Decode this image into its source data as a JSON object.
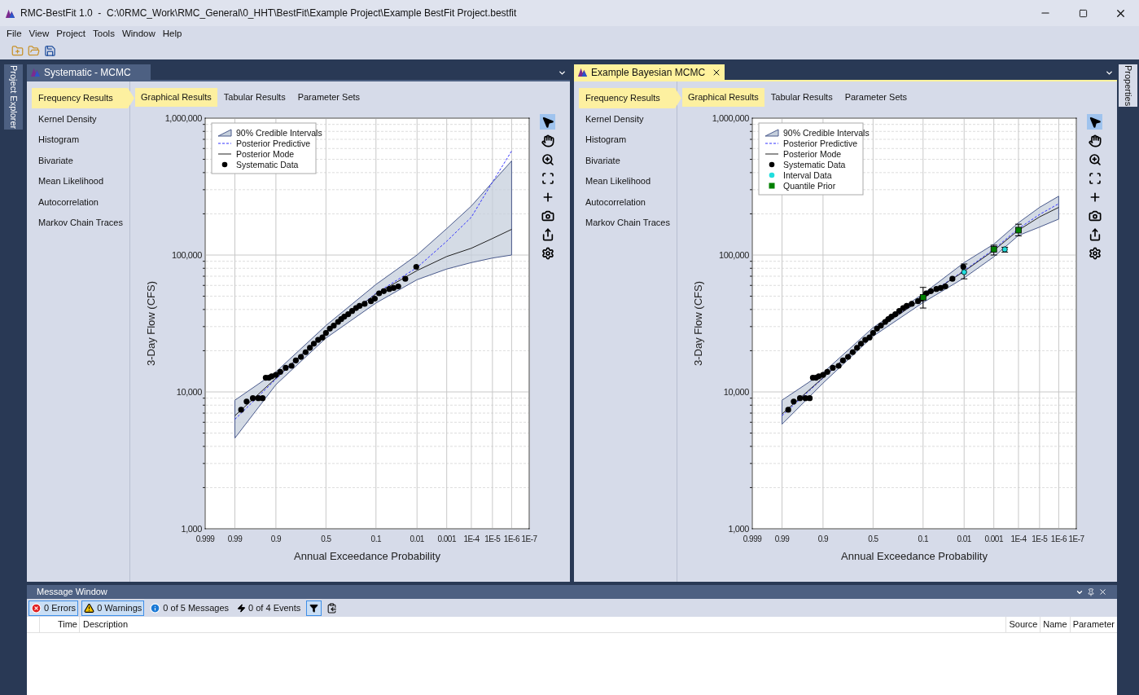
{
  "window": {
    "title": "RMC-BestFit 1.0  -  C:\\0RMC_Work\\RMC_General\\0_HHT\\BestFit\\Example Project\\Example BestFit Project.bestfit"
  },
  "menu": [
    "File",
    "View",
    "Project",
    "Tools",
    "Window",
    "Help"
  ],
  "left_sidebar": {
    "label": "Project Explorer"
  },
  "right_sidebar": {
    "label": "Properties"
  },
  "documents": [
    {
      "title": "Systematic - MCMC",
      "selected": false,
      "nav": [
        {
          "label": "Frequency Results",
          "selected": true
        },
        {
          "label": "Kernel Density",
          "selected": false
        },
        {
          "label": "Histogram",
          "selected": false
        },
        {
          "label": "Bivariate",
          "selected": false
        },
        {
          "label": "Mean Likelihood",
          "selected": false
        },
        {
          "label": "Autocorrelation",
          "selected": false
        },
        {
          "label": "Markov Chain Traces",
          "selected": false
        }
      ],
      "tabs": [
        {
          "label": "Graphical Results",
          "selected": true
        },
        {
          "label": "Tabular Results",
          "selected": false
        },
        {
          "label": "Parameter Sets",
          "selected": false
        }
      ],
      "tools": [
        {
          "kind": "pointer",
          "selected": true
        },
        {
          "kind": "pan",
          "selected": false
        },
        {
          "kind": "zoom",
          "selected": false
        },
        {
          "kind": "fit",
          "selected": false
        },
        {
          "kind": "add",
          "selected": false
        },
        {
          "kind": "camera",
          "selected": false
        },
        {
          "kind": "export",
          "selected": false
        },
        {
          "kind": "settings",
          "selected": false
        }
      ],
      "plot": {
        "x_axis_title": "Annual Exceedance Probability",
        "y_axis_title": "3-Day Flow (CFS)",
        "x_tick_labels": [
          "0.999",
          "0.99",
          "0.9",
          "0.5",
          "0.1",
          "0.01",
          "0.001",
          "1E-4",
          "1E-5",
          "1E-6",
          "1E-7"
        ],
        "y_tick_labels": [
          "1,000,000",
          "100,000",
          "10,000",
          "1,000"
        ],
        "legend": [
          {
            "kind": "band",
            "label": "90% Credible Intervals"
          },
          {
            "kind": "dashed_line",
            "label": "Posterior Predictive"
          },
          {
            "kind": "line",
            "label": "Posterior Mode"
          },
          {
            "kind": "circle",
            "label": "Systematic Data",
            "color": "#000000"
          }
        ]
      }
    },
    {
      "title": "Example Bayesian MCMC",
      "selected": true,
      "nav": [
        {
          "label": "Frequency Results",
          "selected": true
        },
        {
          "label": "Kernel Density",
          "selected": false
        },
        {
          "label": "Histogram",
          "selected": false
        },
        {
          "label": "Bivariate",
          "selected": false
        },
        {
          "label": "Mean Likelihood",
          "selected": false
        },
        {
          "label": "Autocorrelation",
          "selected": false
        },
        {
          "label": "Markov Chain Traces",
          "selected": false
        }
      ],
      "tabs": [
        {
          "label": "Graphical Results",
          "selected": true
        },
        {
          "label": "Tabular Results",
          "selected": false
        },
        {
          "label": "Parameter Sets",
          "selected": false
        }
      ],
      "tools": [
        {
          "kind": "pointer",
          "selected": true
        },
        {
          "kind": "pan",
          "selected": false
        },
        {
          "kind": "zoom",
          "selected": false
        },
        {
          "kind": "fit",
          "selected": false
        },
        {
          "kind": "add",
          "selected": false
        },
        {
          "kind": "camera",
          "selected": false
        },
        {
          "kind": "export",
          "selected": false
        },
        {
          "kind": "settings",
          "selected": false
        }
      ],
      "plot": {
        "x_axis_title": "Annual Exceedance Probability",
        "y_axis_title": "3-Day Flow (CFS)",
        "x_tick_labels": [
          "0.999",
          "0.99",
          "0.9",
          "0.5",
          "0.1",
          "0.01",
          "0.001",
          "1E-4",
          "1E-5",
          "1E-6",
          "1E-7"
        ],
        "y_tick_labels": [
          "1,000,000",
          "100,000",
          "10,000",
          "1,000"
        ],
        "legend": [
          {
            "kind": "band",
            "label": "90% Credible Intervals"
          },
          {
            "kind": "dashed_line",
            "label": "Posterior Predictive"
          },
          {
            "kind": "line",
            "label": "Posterior Mode"
          },
          {
            "kind": "circle",
            "label": "Systematic Data",
            "color": "#000000"
          },
          {
            "kind": "circle",
            "label": "Interval Data",
            "color": "#22dddd"
          },
          {
            "kind": "square",
            "label": "Quantile Prior",
            "color": "#008000"
          }
        ]
      }
    }
  ],
  "message_window": {
    "title": "Message Window",
    "filters": [
      {
        "kind": "error",
        "label": "0 Errors",
        "selected": true
      },
      {
        "kind": "warning",
        "label": "0 Warnings",
        "selected": true
      },
      {
        "kind": "info",
        "label": "0 of 5 Messages",
        "selected": false
      },
      {
        "kind": "event",
        "label": "0 of 4 Events",
        "selected": false
      }
    ],
    "columns": [
      "Time",
      "Description",
      "Source",
      "Name",
      "Parameter"
    ]
  }
}
